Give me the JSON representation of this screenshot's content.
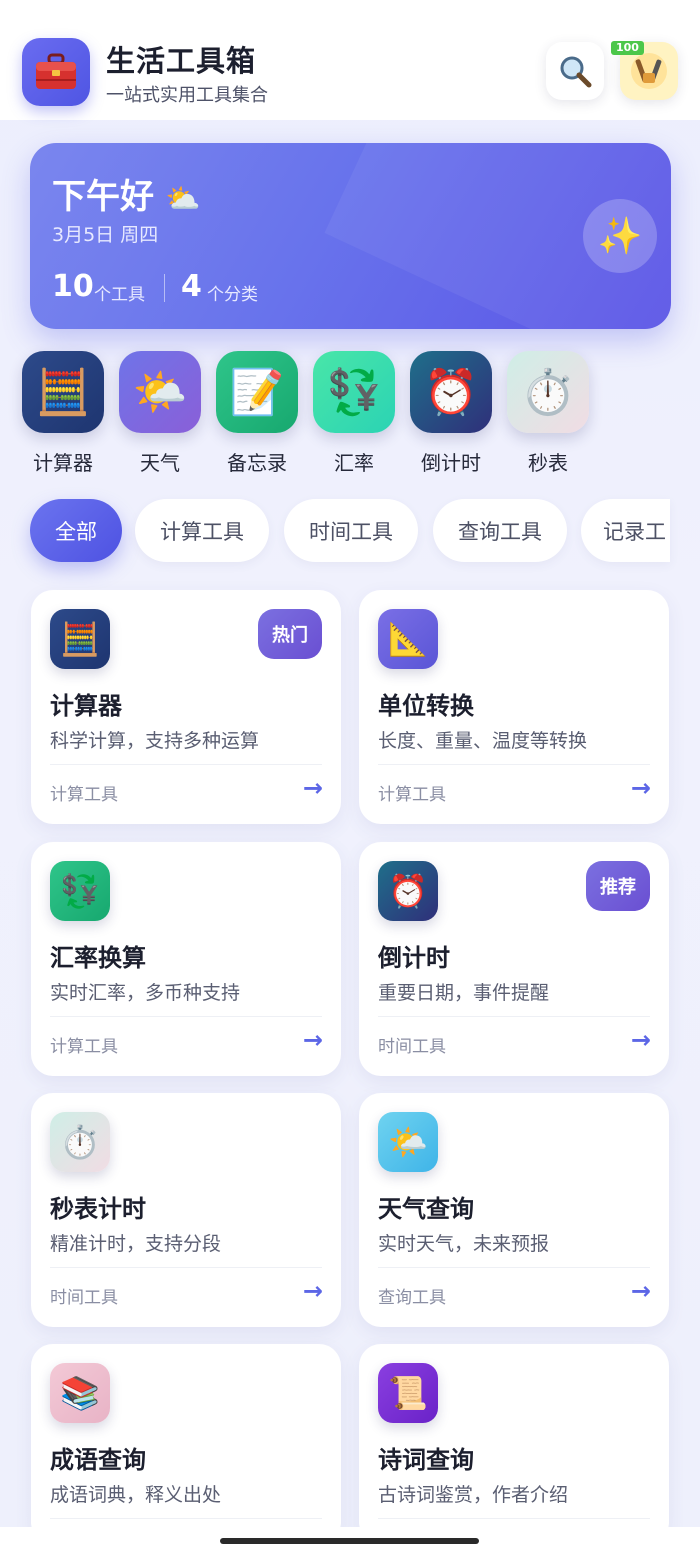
{
  "header": {
    "title": "生活工具箱",
    "subtitle": "一站式实用工具集合",
    "app_icon": "toolbox-icon",
    "search_icon": "search-icon",
    "mini_program_badge": "100"
  },
  "greeting": {
    "title": "下午好",
    "weather_icon": "⛅",
    "date": "3月5日 周四",
    "tools_count": "10",
    "tools_unit": "个工具",
    "categories_count": "4",
    "categories_unit": "个分类",
    "sparkle_icon": "✨"
  },
  "quick_tools": [
    {
      "label": "计算器",
      "icon": "🧮"
    },
    {
      "label": "天气",
      "icon": "🌤️"
    },
    {
      "label": "备忘录",
      "icon": "📝"
    },
    {
      "label": "汇率",
      "icon": "💱"
    },
    {
      "label": "倒计时",
      "icon": "⏰"
    },
    {
      "label": "秒表",
      "icon": "⏱️"
    }
  ],
  "tabs": [
    {
      "label": "全部",
      "active": true
    },
    {
      "label": "计算工具",
      "active": false
    },
    {
      "label": "时间工具",
      "active": false
    },
    {
      "label": "查询工具",
      "active": false
    },
    {
      "label": "记录工",
      "active": false
    }
  ],
  "cards": [
    {
      "title": "计算器",
      "desc": "科学计算，支持多种运算",
      "category": "计算工具",
      "icon": "🧮",
      "badge": "热门"
    },
    {
      "title": "单位转换",
      "desc": "长度、重量、温度等转换",
      "category": "计算工具",
      "icon": "📐",
      "badge": ""
    },
    {
      "title": "汇率换算",
      "desc": "实时汇率，多币种支持",
      "category": "计算工具",
      "icon": "💱",
      "badge": ""
    },
    {
      "title": "倒计时",
      "desc": "重要日期，事件提醒",
      "category": "时间工具",
      "icon": "⏰",
      "badge": "推荐"
    },
    {
      "title": "秒表计时",
      "desc": "精准计时，支持分段",
      "category": "时间工具",
      "icon": "⏱️",
      "badge": ""
    },
    {
      "title": "天气查询",
      "desc": "实时天气，未来预报",
      "category": "查询工具",
      "icon": "🌤️",
      "badge": ""
    },
    {
      "title": "成语查询",
      "desc": "成语词典，释义出处",
      "category": "",
      "icon": "📚",
      "badge": ""
    },
    {
      "title": "诗词查询",
      "desc": "古诗词鉴赏，作者介绍",
      "category": "",
      "icon": "📜",
      "badge": ""
    }
  ],
  "arrow": "→",
  "colors": {
    "accent": "#5c66e6",
    "greeting_bg": "#6873ec",
    "badge": "#6a4fd2"
  }
}
